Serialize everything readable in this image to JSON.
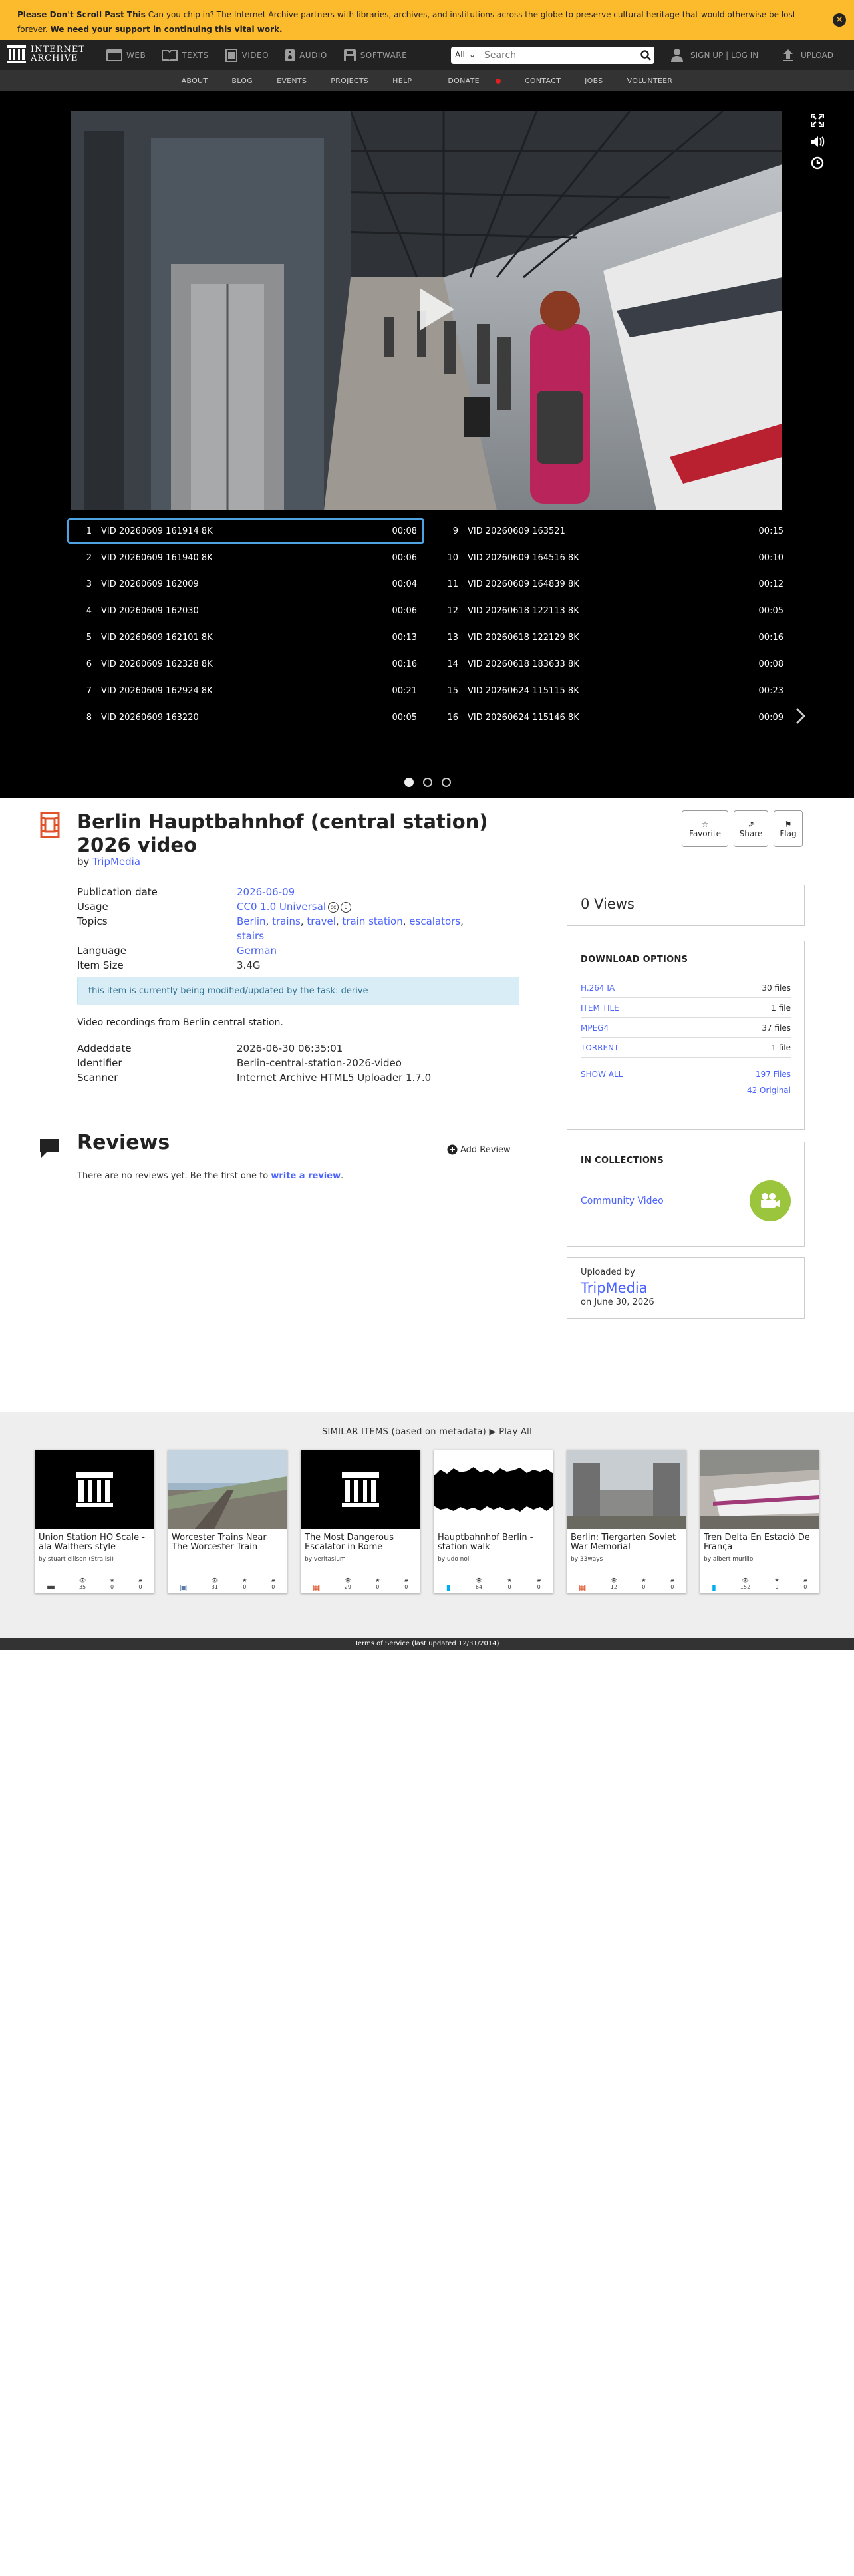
{
  "banner": {
    "bold_lead": "Please Don't Scroll Past This",
    "text": " Can you chip in? The Internet Archive partners with libraries, archives, and institutions across the globe to preserve cultural heritage that would otherwise be lost forever. ",
    "bold_tail": "We need your support in continuing this vital work.",
    "close": "✕"
  },
  "topnav": {
    "logo_line1": "INTERNET",
    "logo_line2": "ARCHIVE",
    "tabs": [
      {
        "label": "WEB",
        "icon": "web-icon"
      },
      {
        "label": "TEXTS",
        "icon": "book-icon"
      },
      {
        "label": "VIDEO",
        "icon": "film-icon"
      },
      {
        "label": "AUDIO",
        "icon": "speaker-icon"
      },
      {
        "label": "SOFTWARE",
        "icon": "floppy-icon"
      }
    ],
    "search_scope": "All",
    "search_placeholder": "Search",
    "user_label": "SIGN UP | LOG IN",
    "upload_label": "UPLOAD"
  },
  "subnav": [
    "ABOUT",
    "BLOG",
    "EVENTS",
    "PROJECTS",
    "HELP",
    "DONATE",
    "CONTACT",
    "JOBS",
    "VOLUNTEER"
  ],
  "playlist": {
    "left": [
      {
        "num": "1",
        "name": "VID 20260609 161914 8K",
        "dur": "00:08"
      },
      {
        "num": "2",
        "name": "VID 20260609 161940 8K",
        "dur": "00:06"
      },
      {
        "num": "3",
        "name": "VID 20260609 162009",
        "dur": "00:04"
      },
      {
        "num": "4",
        "name": "VID 20260609 162030",
        "dur": "00:06"
      },
      {
        "num": "5",
        "name": "VID 20260609 162101 8K",
        "dur": "00:13"
      },
      {
        "num": "6",
        "name": "VID 20260609 162328 8K",
        "dur": "00:16"
      },
      {
        "num": "7",
        "name": "VID 20260609 162924 8K",
        "dur": "00:21"
      },
      {
        "num": "8",
        "name": "VID 20260609 163220",
        "dur": "00:05"
      }
    ],
    "right": [
      {
        "num": "9",
        "name": "VID 20260609 163521",
        "dur": "00:15"
      },
      {
        "num": "10",
        "name": "VID 20260609 164516 8K",
        "dur": "00:10"
      },
      {
        "num": "11",
        "name": "VID 20260609 164839 8K",
        "dur": "00:12"
      },
      {
        "num": "12",
        "name": "VID 20260618 122113 8K",
        "dur": "00:05"
      },
      {
        "num": "13",
        "name": "VID 20260618 122129 8K",
        "dur": "00:16"
      },
      {
        "num": "14",
        "name": "VID 20260618 183633 8K",
        "dur": "00:08"
      },
      {
        "num": "15",
        "name": "VID 20260624 115115 8K",
        "dur": "00:23"
      },
      {
        "num": "16",
        "name": "VID 20260624 115146 8K",
        "dur": "00:09"
      }
    ],
    "active_index": 0,
    "page_count": 3,
    "current_page": 1
  },
  "item": {
    "title": "Berlin Hauptbahnhof (central station) 2026 video",
    "by_prefix": "by ",
    "uploader": "TripMedia",
    "actions": [
      "Favorite",
      "Share",
      "Flag"
    ],
    "metadata": {
      "publication_date_label": "Publication date",
      "publication_date": "2026-06-09",
      "usage_label": "Usage",
      "usage": "CC0 1.0 Universal",
      "topics_label": "Topics",
      "topics": [
        "Berlin",
        "trains",
        "travel",
        "train station",
        "escalators",
        "stairs"
      ],
      "language_label": "Language",
      "language": "German",
      "item_size_label": "Item Size",
      "item_size": "3.4G"
    },
    "notice": "this item is currently being modified/updated by the task: derive",
    "description": "Video recordings from Berlin central station.",
    "extra": {
      "addeddate_label": "Addeddate",
      "addeddate": "2026-06-30 06:35:01",
      "identifier_label": "Identifier",
      "identifier": "Berlin-central-station-2026-video",
      "scanner_label": "Scanner",
      "scanner": "Internet Archive HTML5 Uploader 1.7.0"
    }
  },
  "reviews": {
    "title": "Reviews",
    "add": "Add Review",
    "empty_text": "There are no reviews yet. Be the first one to ",
    "empty_link": "write a review",
    "empty_end": "."
  },
  "sidebar": {
    "views": "0 Views",
    "download_title": "DOWNLOAD OPTIONS",
    "downloads": [
      {
        "label": "H.264 IA",
        "count": "30 files"
      },
      {
        "label": "ITEM TILE",
        "count": "1 file"
      },
      {
        "label": "MPEG4",
        "count": "37 files"
      },
      {
        "label": "TORRENT",
        "count": "1 file"
      }
    ],
    "show_all": "SHOW ALL",
    "all_files": "197 Files",
    "original": "42 Original",
    "collections_title": "IN COLLECTIONS",
    "collection": "Community Video",
    "uploaded_by_label": "Uploaded by",
    "uploaded_by": "TripMedia",
    "uploaded_on": "on June 30, 2026"
  },
  "similar": {
    "heading": "SIMILAR ITEMS (based on metadata)",
    "play_all": "Play All",
    "items": [
      {
        "title": "Union Station HO Scale - ala Walthers style",
        "by": "by stuart ellison (StrailsI)",
        "views": "35",
        "favs": "0",
        "reviews": "0",
        "type": "folder-icon"
      },
      {
        "title": "Worcester Trains Near The Worcester Train",
        "by": "",
        "views": "31",
        "favs": "0",
        "reviews": "0",
        "type": "image-icon"
      },
      {
        "title": "The Most Dangerous Escalator in Rome",
        "by": "by veritasium",
        "views": "29",
        "favs": "0",
        "reviews": "0",
        "type": "film-icon"
      },
      {
        "title": "Hauptbahnhof Berlin - station walk",
        "by": "by udo noll",
        "views": "64",
        "favs": "0",
        "reviews": "0",
        "type": "audio-icon"
      },
      {
        "title": "Berlin: Tiergarten Soviet War Memorial",
        "by": "by 33ways",
        "views": "12",
        "favs": "0",
        "reviews": "0",
        "type": "film-icon"
      },
      {
        "title": "Tren Delta En Estació De França",
        "by": "by albert murillo",
        "views": "152",
        "favs": "0",
        "reviews": "0",
        "type": "audio-icon"
      }
    ]
  },
  "footer": {
    "tos": "Terms of Service (last updated 12/31/2014)"
  },
  "colors": {
    "banner": "#fcbb2d",
    "link": "#4b64ff",
    "collection_green": "#9bc53d",
    "film_icon": "#e0522a"
  }
}
